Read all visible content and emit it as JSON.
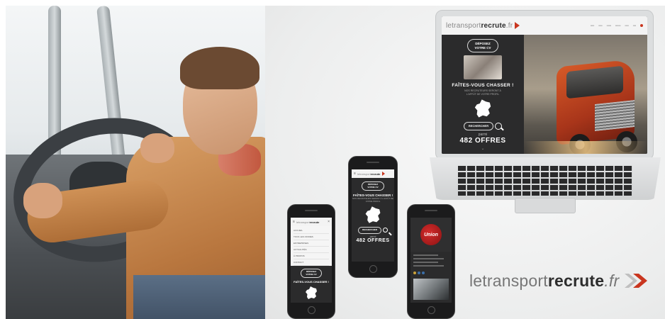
{
  "brand": {
    "name_light": "letransport",
    "name_bold": "recrute",
    "tld": ".fr",
    "accent_color": "#c9361f"
  },
  "laptop_site": {
    "logo_light": "letransport",
    "logo_bold": "recrute",
    "logo_tld": ".fr",
    "cv_button": "DÉPOSEZ VOTRE CV",
    "headline": "FAÎTES-VOUS CHASSER !",
    "subline": "NOS RECRUTEURS SERONT À L'AFFÛT DE VOTRE PROFIL",
    "search_button": "RECHERCHER",
    "among": "parmi",
    "offers": "482 OFFRES",
    "scroll_chevron": "⌄"
  },
  "phone_left": {
    "logo_light": "letransport",
    "logo_bold": "recrute",
    "menu_items": [
      "ACCUEIL",
      "TOUS LES OFFRES",
      "ENTREPRISES",
      "ACTUALITÉS",
      "À PROPOS",
      "CONTACT"
    ],
    "cv_button": "DÉPOSEZ VOTRE CV",
    "headline": "FAÎTES-VOUS CHASSER !"
  },
  "phone_mid": {
    "logo_light": "letransport",
    "logo_bold": "recrute",
    "cv_button": "DÉPOSEZ VOTRE CV",
    "headline": "FAÎTES-VOUS CHASSER !",
    "subline": "NOS RECRUTEURS SERONT À L'AFFÛT DE VOTRE PROFIL",
    "search_button": "RECHERCHER",
    "among": "parmi",
    "offers": "482 OFFRES"
  },
  "phone_right": {
    "company_logo": "Union"
  }
}
